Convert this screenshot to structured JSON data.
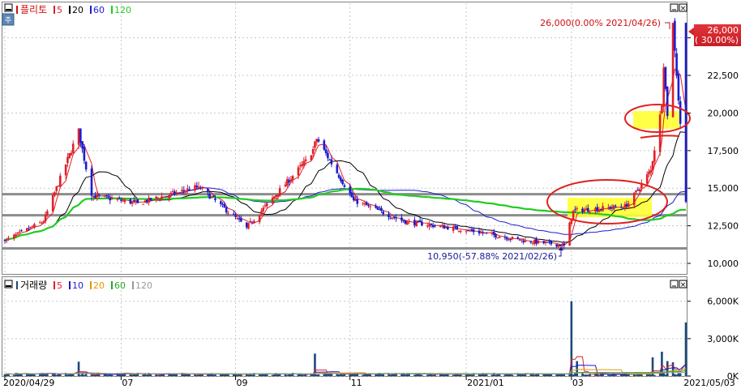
{
  "price_panel": {
    "title": "플리토",
    "ma_legend": [
      {
        "label": "5",
        "color": "#e0202a"
      },
      {
        "label": "20",
        "color": "#000000"
      },
      {
        "label": "60",
        "color": "#1c1ccf"
      },
      {
        "label": "120",
        "color": "#22cc22"
      }
    ],
    "right_badge_value": "26,000",
    "right_badge_pct": "( 30.00%)",
    "high_annotation": "26,000(0.00% 2021/04/26)",
    "low_annotation": "10,950(-57.88% 2021/02/26)"
  },
  "volume_panel": {
    "title": "거래량",
    "ma_legend": [
      {
        "label": "5",
        "color": "#e0202a"
      },
      {
        "label": "10",
        "color": "#1c1ccf"
      },
      {
        "label": "20",
        "color": "#e09a00"
      },
      {
        "label": "60",
        "color": "#22aa22"
      },
      {
        "label": "120",
        "color": "#999999"
      }
    ]
  },
  "x_axis": {
    "ticks": [
      {
        "label": "2020/04/29",
        "date": "2020-04-29"
      },
      {
        "label": "07",
        "date": "2020-07-01"
      },
      {
        "label": "09",
        "date": "2020-09-01"
      },
      {
        "label": "11",
        "date": "2020-11-02"
      },
      {
        "label": "2021/01",
        "date": "2021-01-04"
      },
      {
        "label": "03",
        "date": "2021-03-02"
      }
    ],
    "end_label": "2021/05/03"
  },
  "colors": {
    "up": "#e0202a",
    "down": "#1c1ccf",
    "grid": "#c8c8c8",
    "support_line": "#8c8c8c",
    "highlight": "#ffff33",
    "annotation_circle": "#e02020",
    "volume_bar": "#1a4a7a"
  },
  "chart_data": [
    {
      "type": "candlestick",
      "title": "플리토",
      "x_range": [
        "2020-04-29",
        "2021-05-03"
      ],
      "ylim": [
        9300,
        27300
      ],
      "y_ticks": [
        {
          "value": 10000,
          "label": "10,000"
        },
        {
          "value": 12500,
          "label": "12,500"
        },
        {
          "value": 15000,
          "label": "15,000"
        },
        {
          "value": 17500,
          "label": "17,500"
        },
        {
          "value": 20000,
          "label": "20,000"
        },
        {
          "value": 22500,
          "label": "22,500"
        },
        {
          "value": 25000,
          "label": "25,000"
        }
      ],
      "moving_averages": [
        5,
        20,
        60,
        120
      ],
      "horizontal_lines": [
        14600,
        13200,
        11000
      ],
      "key_points": [
        {
          "date": "2020-04-29",
          "close": 11500
        },
        {
          "date": "2020-05-20",
          "close": 12800
        },
        {
          "date": "2020-06-08",
          "high": 18800
        },
        {
          "date": "2020-06-15",
          "close": 14500
        },
        {
          "date": "2020-07-10",
          "close": 14000
        },
        {
          "date": "2020-08-12",
          "close": 15100
        },
        {
          "date": "2020-09-07",
          "close": 12400
        },
        {
          "date": "2020-10-12",
          "close": 17200
        },
        {
          "date": "2020-10-15",
          "high": 18300
        },
        {
          "date": "2020-11-04",
          "close": 14200
        },
        {
          "date": "2020-12-01",
          "close": 12800
        },
        {
          "date": "2021-01-05",
          "close": 12200
        },
        {
          "date": "2021-02-05",
          "close": 11500
        },
        {
          "date": "2021-02-26",
          "low": 10950,
          "close": 11200
        },
        {
          "date": "2021-03-03",
          "close": 13500
        },
        {
          "date": "2021-04-01",
          "close": 13800
        },
        {
          "date": "2021-04-14",
          "close": 16200
        },
        {
          "date": "2021-04-20",
          "close": 20500
        },
        {
          "date": "2021-04-21",
          "high": 23300
        },
        {
          "date": "2021-04-23",
          "close": 19800
        },
        {
          "date": "2021-04-26",
          "high": 26000,
          "close": 26000
        },
        {
          "date": "2021-05-03",
          "open": 26000,
          "low": 14000,
          "close": 14100
        }
      ]
    },
    {
      "type": "bar",
      "title": "거래량",
      "ylim": [
        0,
        6500000
      ],
      "y_ticks": [
        {
          "value": 0,
          "label": "0K"
        },
        {
          "value": 3000000,
          "label": "3,000K"
        },
        {
          "value": 6000000,
          "label": "6,000K"
        }
      ],
      "moving_averages": [
        5,
        10,
        20,
        60,
        120
      ],
      "spikes": [
        {
          "date": "2020-06-08",
          "value": 1150000
        },
        {
          "date": "2020-10-14",
          "value": 1800000
        },
        {
          "date": "2021-03-02",
          "value": 6000000
        },
        {
          "date": "2021-03-05",
          "value": 1200000
        },
        {
          "date": "2021-04-15",
          "value": 1500000
        },
        {
          "date": "2021-04-20",
          "value": 1950000
        },
        {
          "date": "2021-04-23",
          "value": 1200000
        },
        {
          "date": "2021-04-26",
          "value": 1100000
        },
        {
          "date": "2021-05-03",
          "value": 4300000
        }
      ]
    }
  ]
}
